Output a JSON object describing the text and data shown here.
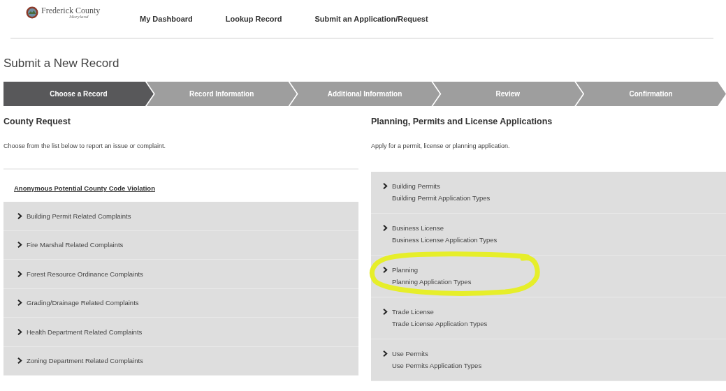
{
  "logo": {
    "name": "Frederick County",
    "state": "Maryland"
  },
  "nav": [
    {
      "label": "My Dashboard"
    },
    {
      "label": "Lookup Record"
    },
    {
      "label": "Submit an Application/Request"
    }
  ],
  "page_title": "Submit a New Record",
  "steps": [
    {
      "label": "Choose a Record",
      "selected": true
    },
    {
      "label": "Record Information",
      "selected": false
    },
    {
      "label": "Additional Information",
      "selected": false
    },
    {
      "label": "Review",
      "selected": false
    },
    {
      "label": "Confirmation",
      "selected": false
    }
  ],
  "county_request": {
    "heading": "County Request",
    "description": "Choose from the list below to report an issue or complaint.",
    "link": "Anonymous Potential County Code Violation",
    "items": [
      {
        "label": "Building Permit Related Complaints"
      },
      {
        "label": "Fire Marshal Related Complaints"
      },
      {
        "label": "Forest Resource Ordinance Complaints"
      },
      {
        "label": "Grading/Drainage Related Complaints"
      },
      {
        "label": "Health Department Related Complaints"
      },
      {
        "label": "Zoning Department Related Complaints"
      }
    ]
  },
  "applications": {
    "heading": "Planning, Permits and License Applications",
    "description": "Apply for a permit, license or planning application.",
    "items": [
      {
        "label": "Building Permits",
        "sub": "Building Permit Application Types",
        "highlighted": false
      },
      {
        "label": "Business License",
        "sub": "Business License Application Types",
        "highlighted": false
      },
      {
        "label": "Planning",
        "sub": "Planning Application Types",
        "highlighted": true
      },
      {
        "label": "Trade License",
        "sub": "Trade License Application Types",
        "highlighted": false
      },
      {
        "label": "Use Permits",
        "sub": "Use Permits Application Types",
        "highlighted": false
      }
    ]
  }
}
